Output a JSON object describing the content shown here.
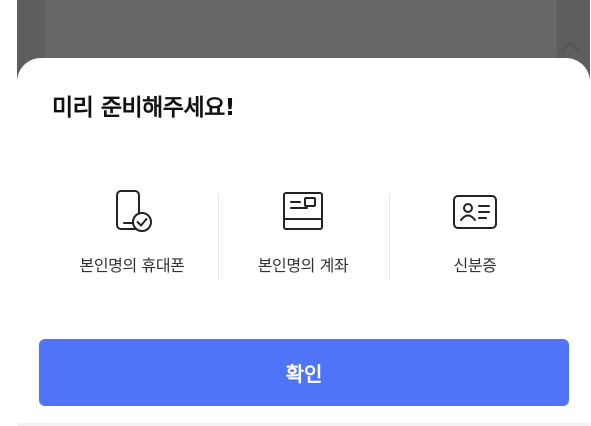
{
  "sheet": {
    "title": "미리 준비해주세요!",
    "items": [
      {
        "label": "본인명의 휴대폰",
        "icon": "phone-check-icon"
      },
      {
        "label": "본인명의 계좌",
        "icon": "bank-card-icon"
      },
      {
        "label": "신분증",
        "icon": "id-card-icon"
      }
    ],
    "confirm_label": "확인"
  },
  "colors": {
    "accent": "#4f74f7",
    "title_text": "#111111",
    "label_text": "#333333",
    "backdrop": "#5e5e5e"
  }
}
